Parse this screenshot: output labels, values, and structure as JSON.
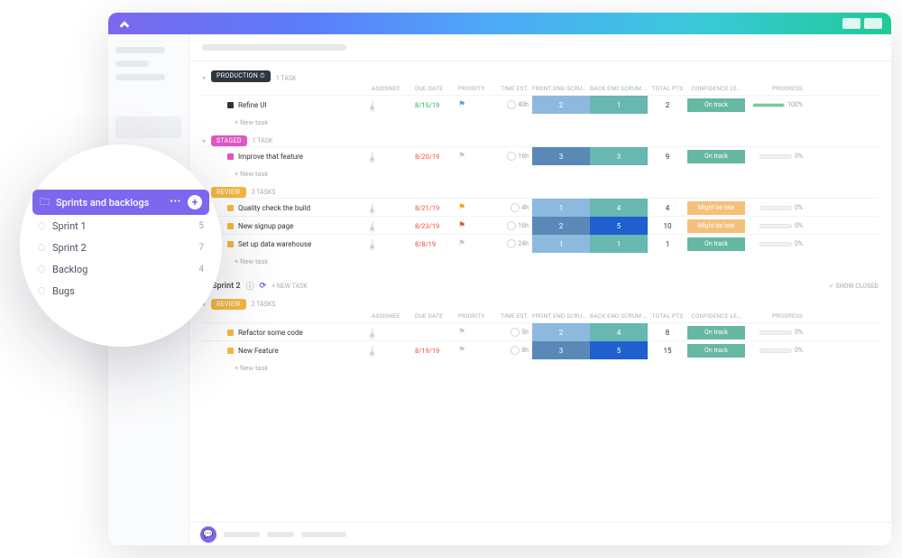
{
  "columns": {
    "assignee": "ASSIGNEE",
    "due": "DUE DATE",
    "priority": "PRIORITY",
    "est": "TIME EST.",
    "front": "FRONT END SCRUM PTS",
    "back": "BACK END SCRUM PTS",
    "total": "TOTAL PTS",
    "conf": "CONFIDENCE LE…",
    "progress": "PROGRESS"
  },
  "new_task": "+ New task",
  "plus_new_task": "+ NEW TASK",
  "show_closed": "✓ SHOW CLOSED",
  "groups": [
    {
      "label": "PRODUCTION",
      "color": "#2f3640",
      "meta": "1 TASK",
      "has_clock": true,
      "rows": [
        {
          "name": "Refine UI",
          "sq": "#2f3640",
          "due": "8/15/19",
          "dueColor": "#27ae60",
          "pri": "#5f9edb",
          "est": "40h",
          "front": "2",
          "back": "1",
          "frontBg": "#8db9de",
          "backBg": "#68b7b0",
          "total": "2",
          "conf": "On track",
          "confBg": "#66b8a3",
          "pct": "100%",
          "fill": 100,
          "fillColor": "#6fcf97"
        }
      ]
    },
    {
      "label": "STAGED",
      "color": "#e056c4",
      "meta": "1 TASK",
      "has_clock": false,
      "rows": [
        {
          "name": "Improve that feature",
          "sq": "#e056c4",
          "due": "8/20/19",
          "dueColor": "#e74c3c",
          "pri": "#c9c9c9",
          "est": "16h",
          "front": "3",
          "back": "3",
          "frontBg": "#5a89b8",
          "backBg": "#68b7b0",
          "total": "9",
          "conf": "On track",
          "confBg": "#66b8a3",
          "pct": "0%",
          "fill": 0
        }
      ]
    },
    {
      "label": "REVIEW",
      "color": "#f4b740",
      "meta": "3 TASKS",
      "has_clock": false,
      "rows": [
        {
          "name": "Quality check the build",
          "sq": "#f4b740",
          "due": "8/21/19",
          "dueColor": "#e74c3c",
          "pri": "#f39c12",
          "est": "4h",
          "front": "1",
          "back": "4",
          "frontBg": "#8db9de",
          "backBg": "#68b7b0",
          "total": "4",
          "conf": "Might be late",
          "confBg": "#f4c07a",
          "pct": "0%",
          "fill": 0
        },
        {
          "name": "New signup page",
          "sq": "#f4b740",
          "due": "8/23/19",
          "dueColor": "#e74c3c",
          "pri": "#e74c3c",
          "est": "16h",
          "front": "2",
          "back": "5",
          "frontBg": "#5a89b8",
          "backBg": "#1f5fd0",
          "total": "10",
          "conf": "Might be late",
          "confBg": "#f4c07a",
          "pct": "0%",
          "fill": 0
        },
        {
          "name": "Set up data warehouse",
          "sq": "#f4b740",
          "due": "8/8/19",
          "dueColor": "#e74c3c",
          "pri": "#c9c9c9",
          "est": "24h",
          "front": "1",
          "back": "1",
          "frontBg": "#8db9de",
          "backBg": "#68b7b0",
          "total": "1",
          "conf": "On track",
          "confBg": "#66b8a3",
          "pct": "0%",
          "fill": 0
        }
      ]
    }
  ],
  "section_title": "Sprint 2",
  "groups2": [
    {
      "label": "REVIEW",
      "color": "#f4b740",
      "meta": "2 TASKS",
      "rows": [
        {
          "name": "Refactor some code",
          "sq": "#f4b740",
          "due": "",
          "dueColor": "#999",
          "pri": "#c9c9c9",
          "est": "5h",
          "front": "2",
          "back": "4",
          "frontBg": "#8db9de",
          "backBg": "#68b7b0",
          "total": "8",
          "conf": "On track",
          "confBg": "#66b8a3",
          "pct": "0%",
          "fill": 0
        },
        {
          "name": "New Feature",
          "sq": "#f4b740",
          "due": "8/19/19",
          "dueColor": "#e74c3c",
          "pri": "#c9c9c9",
          "est": "8h",
          "front": "3",
          "back": "5",
          "frontBg": "#5a89b8",
          "backBg": "#1f5fd0",
          "total": "15",
          "conf": "On track",
          "confBg": "#66b8a3",
          "pct": "0%",
          "fill": 0
        }
      ]
    }
  ],
  "popout": {
    "title": "Sprints and backlogs",
    "items": [
      {
        "label": "Sprint 1",
        "count": "5"
      },
      {
        "label": "Sprint 2",
        "count": "7"
      },
      {
        "label": "Backlog",
        "count": "4"
      },
      {
        "label": "Bugs",
        "count": ""
      }
    ]
  }
}
